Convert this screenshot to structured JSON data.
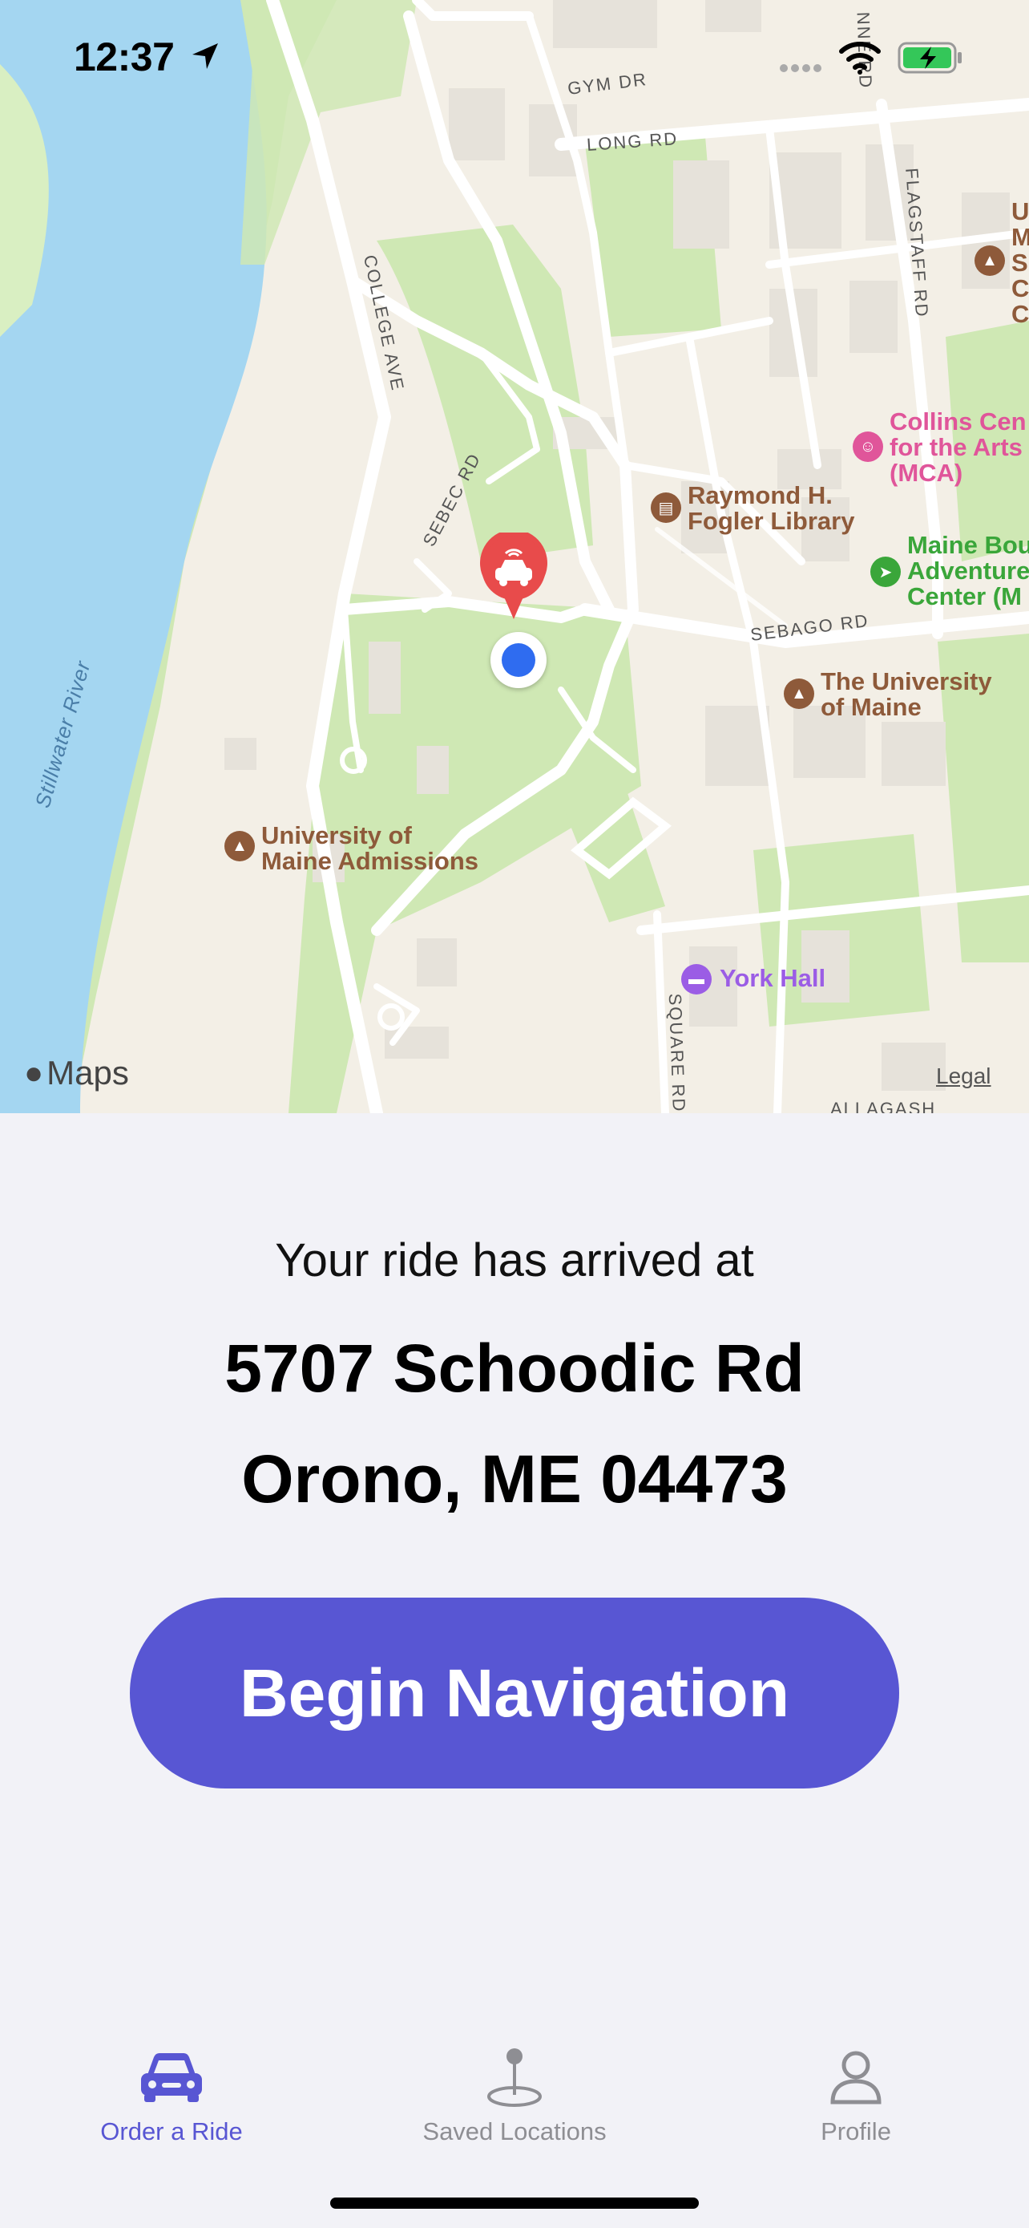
{
  "status_bar": {
    "time": "12:37",
    "icons": [
      "location-arrow-icon",
      "signal-icon",
      "wifi-icon",
      "battery-charging-icon"
    ]
  },
  "map": {
    "attribution": "Maps",
    "legal": "Legal",
    "streets": {
      "gym_dr": "GYM DR",
      "long_rd": "LONG RD",
      "college_ave": "COLLEGE AVE",
      "sebec_rd": "SEBEC RD",
      "flagstaff_rd": "FLAGSTAFF RD",
      "sebago_rd": "SEBAGO RD",
      "square_rd": "SQUARE RD",
      "allagash": "ALLAGASH",
      "munson_rd": "NNE RD"
    },
    "river": "Stillwater River",
    "pois": {
      "collins": "Collins Cen\nfor the Arts\n(MCA)",
      "library": "Raymond H.\nFogler Library",
      "maine_bound": "Maine Bou\nAdventure\nCenter (M",
      "umaine": "The University\nof Maine",
      "admissions": "University of\nMaine Admissions",
      "york_hall": "York Hall",
      "top_right": "U\nM\nS\nC\nC"
    },
    "colors": {
      "water": "#a4d6f1",
      "park": "#cfe8b4",
      "road": "#ffffff",
      "poi_brown": "#8e5a3a",
      "poi_pink": "#e0559a",
      "poi_green": "#3aa63a",
      "poi_purple": "#9b5de5",
      "car_pin": "#e84b4b",
      "user_dot": "#2f6cf0"
    }
  },
  "ride": {
    "arrived_label": "Your ride has arrived at",
    "address_line1": "5707 Schoodic Rd",
    "address_line2": "Orono, ME 04473",
    "begin_navigation": "Begin Navigation"
  },
  "tab_bar": {
    "accent": "#5856d3",
    "inactive": "#8e8e93",
    "tabs": [
      {
        "label": "Order a Ride",
        "icon": "car-icon",
        "selected": true
      },
      {
        "label": "Saved Locations",
        "icon": "map-pin-icon",
        "selected": false
      },
      {
        "label": "Profile",
        "icon": "person-icon",
        "selected": false
      }
    ]
  }
}
